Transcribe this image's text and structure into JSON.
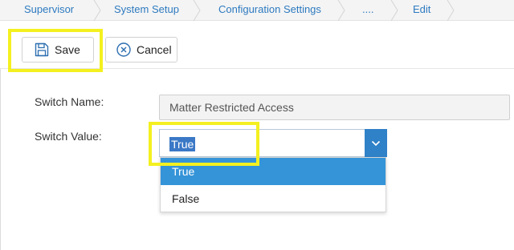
{
  "breadcrumb": {
    "items": [
      "Supervisor",
      "System Setup",
      "Configuration Settings",
      "....",
      "Edit"
    ]
  },
  "toolbar": {
    "save_label": "Save",
    "cancel_label": "Cancel"
  },
  "form": {
    "switch_name_label": "Switch Name:",
    "switch_name_value": "Matter Restricted Access",
    "switch_value_label": "Switch Value:",
    "switch_value_selected": "True",
    "options": [
      "True",
      "False"
    ]
  },
  "colors": {
    "link": "#2d7ac0",
    "highlight": "#f4f020",
    "selected_option": "#3594d8",
    "select_arrow": "#2f81c8"
  }
}
